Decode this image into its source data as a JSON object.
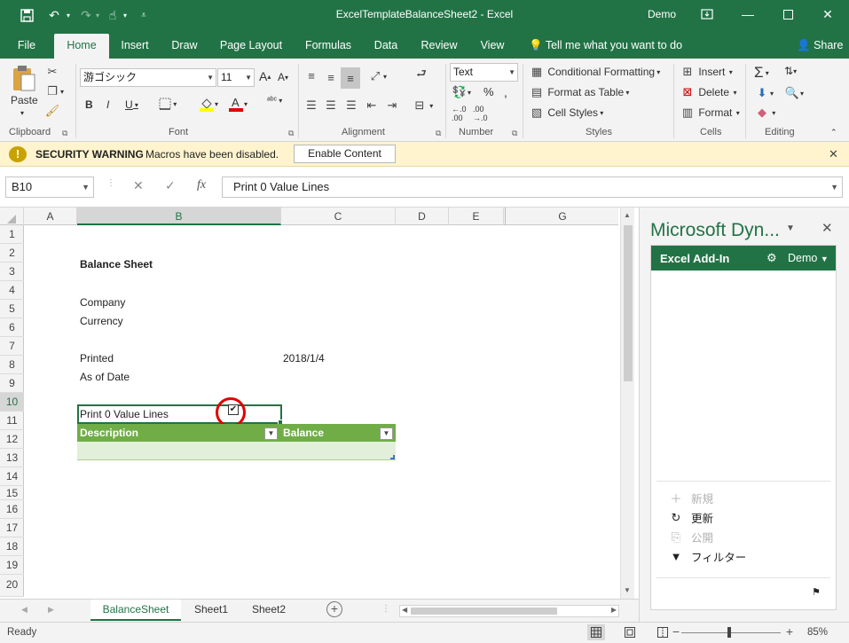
{
  "titlebar": {
    "title": "ExcelTemplateBalanceSheet2  -  Excel",
    "user": "Demo"
  },
  "tabs": [
    "File",
    "Home",
    "Insert",
    "Draw",
    "Page Layout",
    "Formulas",
    "Data",
    "Review",
    "View"
  ],
  "active_tab": "Home",
  "tellme": "Tell me what you want to do",
  "share": "Share",
  "ribbon": {
    "clipboard": {
      "label": "Clipboard",
      "paste": "Paste"
    },
    "font": {
      "label": "Font",
      "family": "游ゴシック",
      "size": "11"
    },
    "alignment": {
      "label": "Alignment"
    },
    "number": {
      "label": "Number",
      "format": "Text"
    },
    "styles": {
      "label": "Styles",
      "conditional": "Conditional Formatting",
      "format_table": "Format as Table",
      "cell_styles": "Cell Styles"
    },
    "cells": {
      "label": "Cells",
      "insert": "Insert",
      "delete": "Delete",
      "format": "Format"
    },
    "editing": {
      "label": "Editing"
    }
  },
  "security": {
    "title": "SECURITY WARNING",
    "message": "Macros have been disabled.",
    "button": "Enable Content"
  },
  "formula_bar": {
    "name_box": "B10",
    "formula": "Print 0 Value Lines"
  },
  "grid": {
    "columns": [
      "A",
      "B",
      "C",
      "D",
      "E",
      "G"
    ],
    "selected_column": "B",
    "rows": [
      "1",
      "2",
      "3",
      "4",
      "5",
      "6",
      "7",
      "8",
      "9",
      "10",
      "11",
      "12",
      "13",
      "14",
      "15",
      "16",
      "17",
      "18",
      "19",
      "20"
    ],
    "selected_row": "10",
    "cells": {
      "b2": "Balance Sheet",
      "b4": "Company",
      "b5": "Currency",
      "b7": "Printed",
      "c7": "2018/1/4",
      "b8": "As of Date",
      "b10": "Print 0 Value Lines",
      "checkbox_checked": true
    },
    "table": {
      "header_desc": "Description",
      "header_balance": "Balance"
    }
  },
  "sheet_tabs": [
    "BalanceSheet",
    "Sheet1",
    "Sheet2"
  ],
  "active_sheet": "BalanceSheet",
  "pane": {
    "title": "Microsoft Dyn...",
    "addin": "Excel Add-In",
    "user": "Demo",
    "actions": [
      {
        "label": "新規",
        "icon": "plus-icon",
        "enabled": false
      },
      {
        "label": "更新",
        "icon": "refresh-icon",
        "enabled": true
      },
      {
        "label": "公開",
        "icon": "publish-icon",
        "enabled": false
      },
      {
        "label": "フィルター",
        "icon": "filter-icon",
        "enabled": true
      }
    ]
  },
  "status": {
    "ready": "Ready",
    "zoom": "85%"
  },
  "colors": {
    "excel_green": "#217346",
    "table_header": "#70ad47",
    "table_band": "#e2efda",
    "security_bg": "#fff4ce",
    "highlight_circle": "#e00000"
  }
}
